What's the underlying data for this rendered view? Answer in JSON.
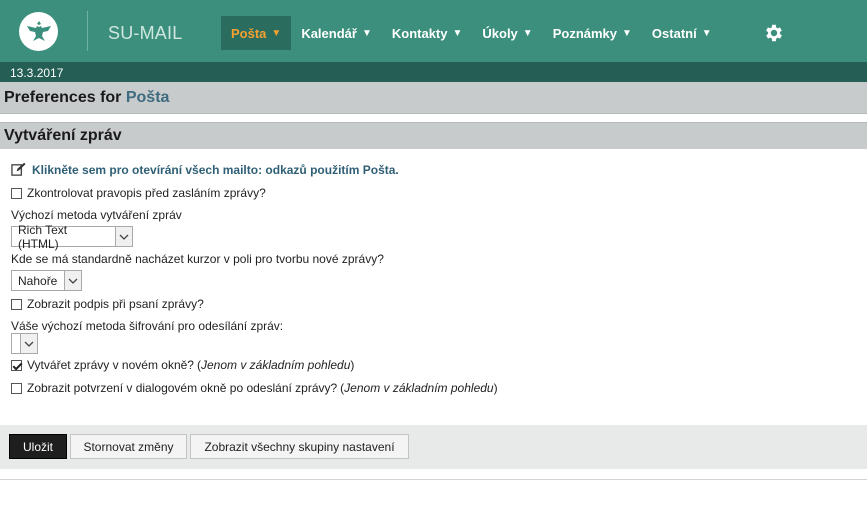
{
  "header": {
    "app_title": "SU-MAIL",
    "menu": [
      {
        "label": "Pošta",
        "active": true
      },
      {
        "label": "Kalendář",
        "active": false
      },
      {
        "label": "Kontakty",
        "active": false
      },
      {
        "label": "Úkoly",
        "active": false
      },
      {
        "label": "Poznámky",
        "active": false
      },
      {
        "label": "Ostatní",
        "active": false
      }
    ],
    "settings_icon": "gear-icon",
    "logo_icon": "eagle-logo-icon"
  },
  "date": "13.3.2017",
  "preferences": {
    "title_prefix": "Preferences for",
    "app_name": "Pošta"
  },
  "section": {
    "title": "Vytváření zpráv",
    "mailto_link": "Klikněte sem pro otevírání všech mailto: odkazů použitím Pošta.",
    "spellcheck_label": "Zkontrolovat pravopis před zasláním zprávy?",
    "spellcheck_checked": false,
    "compose_method_label": "Výchozí metoda vytváření zpráv",
    "compose_method_value": "Rich Text (HTML)",
    "cursor_label": "Kde se má standardně nacházet kurzor v poli pro tvorbu nové zprávy?",
    "cursor_value": "Nahoře",
    "signature_label": "Zobrazit podpis při psaní zprávy?",
    "signature_checked": false,
    "encryption_label": "Váše výchozí metoda šifrování pro odesílání zpráv:",
    "encryption_value": "",
    "new_window_label": "Vytvářet zprávy v novém okně?",
    "new_window_note": "Jenom v základním pohledu",
    "new_window_checked": true,
    "confirm_label": "Zobrazit potvrzení v dialogovém okně po odeslání zprávy?",
    "confirm_note": "Jenom v základním pohledu",
    "confirm_checked": false
  },
  "buttons": {
    "save": "Uložit",
    "cancel": "Stornovat změny",
    "show_all": "Zobrazit všechny skupiny nastavení"
  },
  "colors": {
    "topbar": "#3b8f7c",
    "datebar": "#245e54",
    "active_menu": "#f4a030"
  }
}
